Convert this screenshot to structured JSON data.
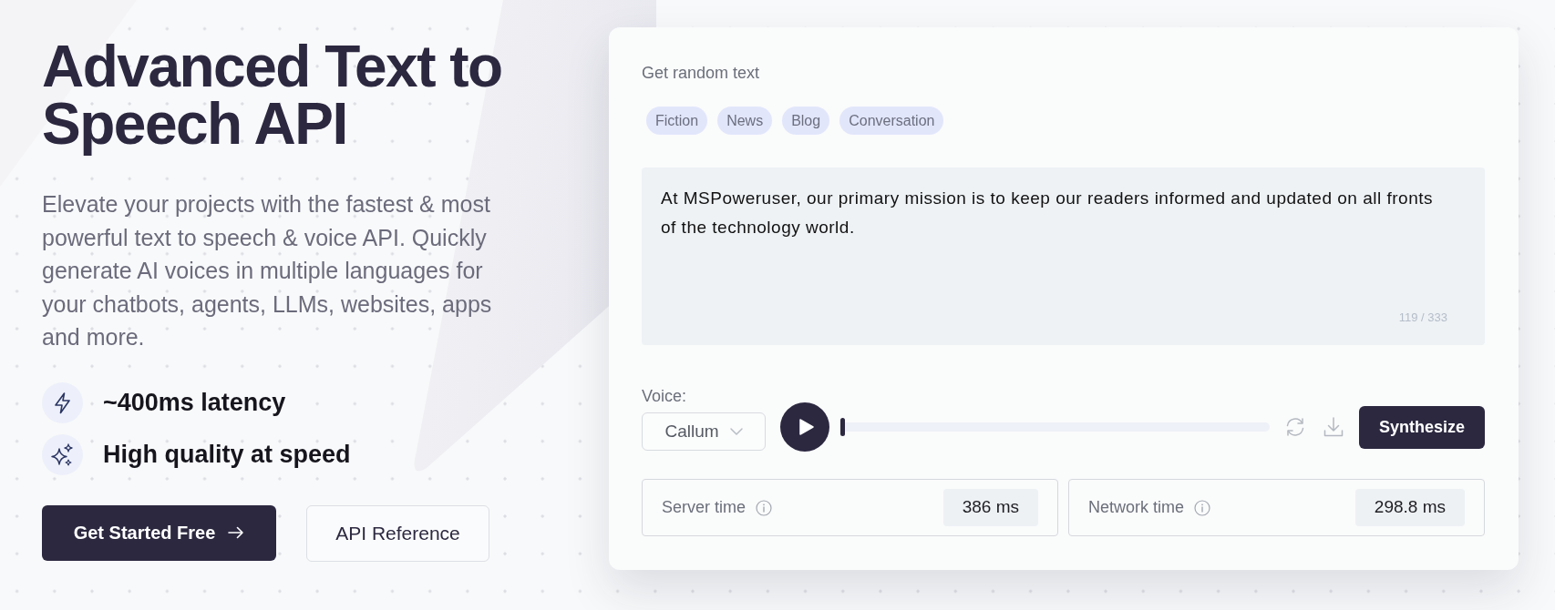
{
  "hero": {
    "title": "Advanced Text to Speech API",
    "description": "Elevate your projects with the fastest & most powerful text to speech & voice API. Quickly generate AI voices in multiple languages for your chatbots, agents, LLMs, websites, apps and more.",
    "features": [
      {
        "kind": "latency",
        "text": "~400ms latency"
      },
      {
        "kind": "quality",
        "text": "High quality at speed"
      }
    ],
    "buttons": [
      {
        "kind": "primary",
        "label": "Get Started Free"
      },
      {
        "kind": "secondary",
        "label": "API Reference"
      }
    ]
  },
  "demo": {
    "random_text_label": "Get random text",
    "categories": [
      "Fiction",
      "News",
      "Blog",
      "Conversation"
    ],
    "text_input": {
      "value": "At MSPoweruser, our primary mission is to keep our readers informed and updated on all fronts of the technology world.",
      "counter": "119 / 333"
    },
    "voice": {
      "label": "Voice:",
      "value": "Callum"
    },
    "player": {
      "level": 0
    },
    "synthesize_button": "Synthesize",
    "stats": [
      {
        "label": "Server time",
        "value": "386 ms"
      },
      {
        "label": "Network time",
        "value": "298.8 ms"
      }
    ]
  }
}
